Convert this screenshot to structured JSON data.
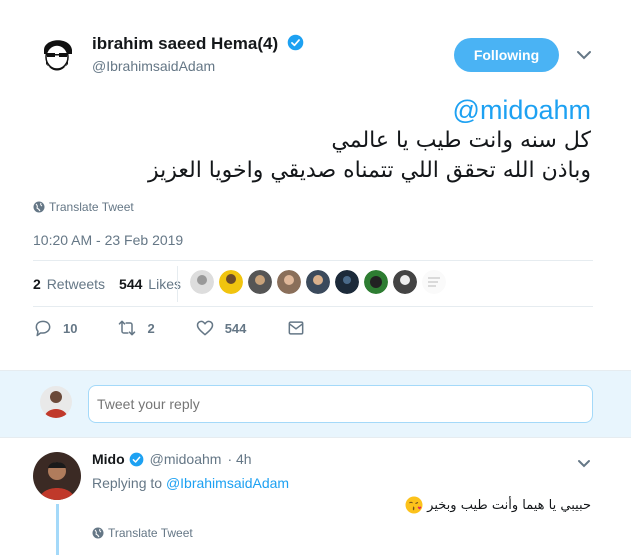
{
  "tweet": {
    "display_name": "ibrahim saeed Hema(4)",
    "handle": "@IbrahimsaidAdam",
    "follow_label": "Following",
    "mention": "@midoahm",
    "line1": "كل سنه وانت طيب يا عالمي",
    "line2": "وباذن الله تحقق اللي تتمناه صديقي واخويا العزيز",
    "translate_label": "Translate Tweet",
    "timestamp": "10:20 AM - 23 Feb 2019",
    "retweets_count": "2",
    "retweets_label": "Retweets",
    "likes_count": "544",
    "likes_label": "Likes",
    "replies_action": "10",
    "retweets_action": "2",
    "likes_action": "544"
  },
  "reply_box": {
    "placeholder": "Tweet your reply"
  },
  "reply": {
    "display_name": "Mido",
    "handle": "@midoahm",
    "time": "· 4h",
    "replying_prefix": "Replying to",
    "replying_to": "@IbrahimsaidAdam",
    "text": "حبيبي يا هيما وأنت طيب وبخير",
    "translate_label": "Translate Tweet"
  },
  "colors": {
    "accent": "#1da1f2",
    "follow_button": "#4ab3f4",
    "muted": "#657786",
    "reply_bg": "#e8f5fd"
  }
}
